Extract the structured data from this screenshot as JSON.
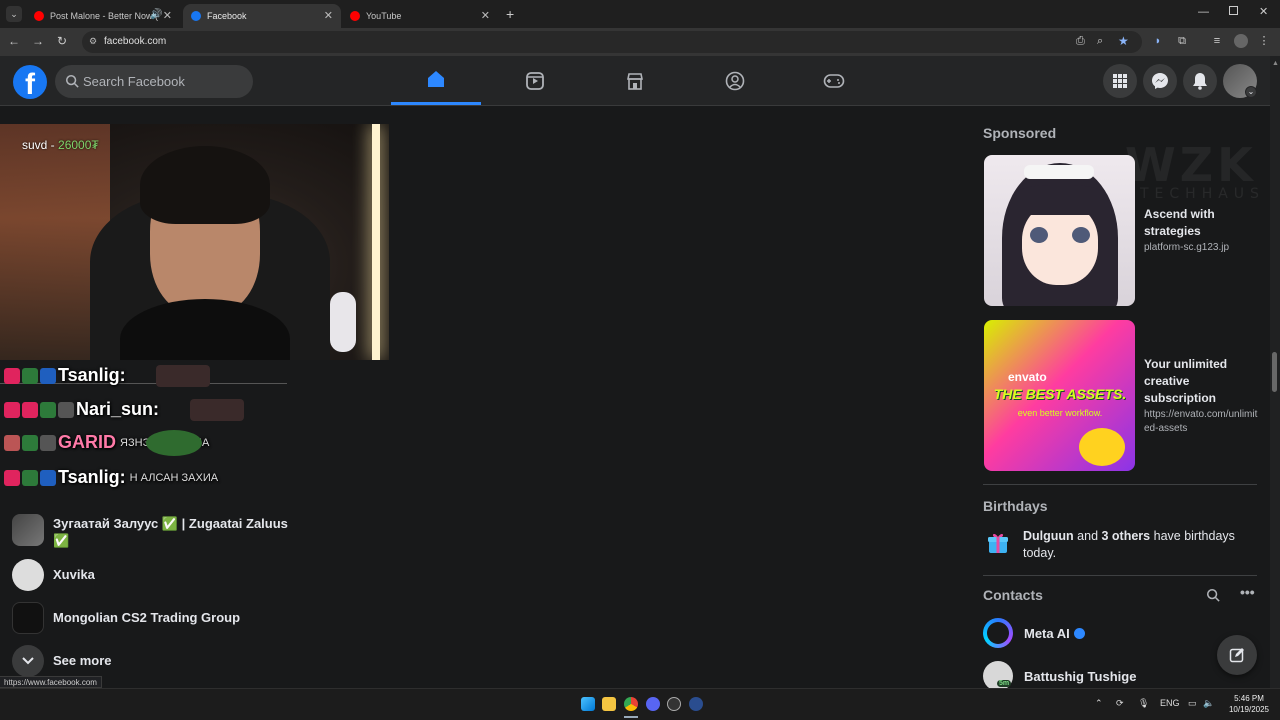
{
  "browser": {
    "tabs": [
      {
        "title": "Post Malone - Better Now (",
        "favicon_color": "#ff0000",
        "active": false
      },
      {
        "title": "Facebook",
        "favicon_color": "#1877f2",
        "active": true
      },
      {
        "title": "YouTube",
        "favicon_color": "#ff0000",
        "active": false
      }
    ],
    "url": "facebook.com",
    "status_url": "https://www.facebook.com"
  },
  "fb_header": {
    "logo_letter": "f",
    "search_placeholder": "Search Facebook",
    "nav": [
      "home-icon",
      "video-icon",
      "marketplace-icon",
      "groups-icon",
      "gaming-icon"
    ]
  },
  "video": {
    "overlay_name": "suvd - ",
    "overlay_amount": "26000₮"
  },
  "chat_overlay": [
    {
      "name": "Tsanlig:"
    },
    {
      "name": "Nari_sun:"
    },
    {
      "name": "GARID",
      "text": "ЯЗНЭЭ ДАЛ ХИА"
    },
    {
      "name": "Tsanlig:",
      "text": "Н АЛСАН ЗАХИА"
    }
  ],
  "groups": [
    {
      "name": "Зугаатай Залуус ✅ | Zugaatai Zaluus",
      "extra": "✅"
    },
    {
      "name": "Xuvika"
    },
    {
      "name": "Mongolian CS2 Trading Group"
    }
  ],
  "see_more": "See more",
  "sponsored": {
    "heading": "Sponsored",
    "ads": [
      {
        "title": "Ascend with strategies",
        "url": "platform-sc.g123.jp"
      },
      {
        "title": "Your unlimited creative subscription",
        "url": "https://envato.com/unlimited-assets",
        "img_brand": "envato",
        "img_headline": "THE BEST ASSETS.",
        "img_sub": "even better workflow."
      }
    ]
  },
  "birthdays": {
    "heading": "Birthdays",
    "name": "Dulguun",
    "and": " and ",
    "others": "3 others",
    "rest": " have birthdays today."
  },
  "contacts": {
    "heading": "Contacts",
    "items": [
      {
        "name": "Meta AI",
        "verified": true
      },
      {
        "name": "Battushig Tushige",
        "status": "5m"
      }
    ]
  },
  "watermark": {
    "main": "WZK",
    "sub": "TECHHAUS"
  },
  "taskbar": {
    "lang": "ENG",
    "time": "5:46 PM",
    "date": "10/19/2025"
  }
}
